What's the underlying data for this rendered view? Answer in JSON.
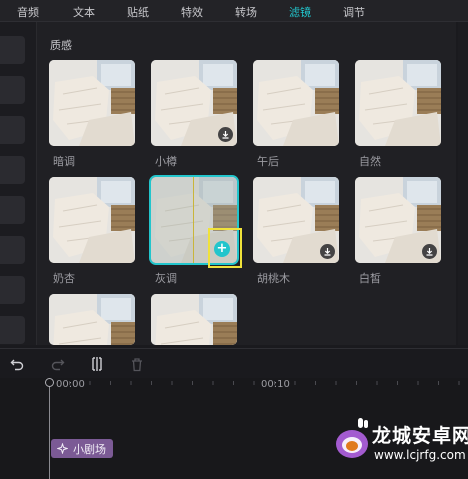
{
  "tabs": [
    {
      "label": "音频"
    },
    {
      "label": "文本"
    },
    {
      "label": "贴纸"
    },
    {
      "label": "特效"
    },
    {
      "label": "转场"
    },
    {
      "label": "滤镜",
      "active": true
    },
    {
      "label": "调节"
    }
  ],
  "panel": {
    "section_title": "质感",
    "filters": [
      {
        "label": "暗调",
        "badge": "none"
      },
      {
        "label": "小樽",
        "badge": "download-icon"
      },
      {
        "label": "午后",
        "badge": "none"
      },
      {
        "label": "自然",
        "badge": "none"
      },
      {
        "label": "奶杏",
        "badge": "none"
      },
      {
        "label": "灰调",
        "badge": "add-icon",
        "selected": true
      },
      {
        "label": "胡桃木",
        "badge": "download-icon"
      },
      {
        "label": "白皙",
        "badge": "download-icon"
      },
      {
        "label": "",
        "badge": "none"
      },
      {
        "label": "",
        "badge": "none"
      }
    ],
    "add_symbol": "+"
  },
  "toolbar": {
    "icons": [
      "undo-icon",
      "redo-icon",
      "split-icon",
      "delete-icon"
    ]
  },
  "timeline": {
    "ticks": [
      "00:00",
      "00:10"
    ],
    "clip_label": "小剧场"
  },
  "watermark": {
    "title": "龙城安卓网",
    "url": "www.lcjrfg.com"
  },
  "colors": {
    "accent": "#22c5cc",
    "highlight": "#f0e23a",
    "clip": "#7b5a95"
  }
}
